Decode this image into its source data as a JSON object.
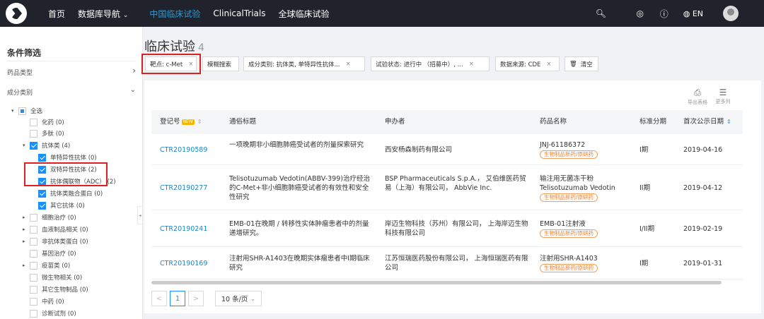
{
  "nav": {
    "home": "首页",
    "db_nav": "数据库导航",
    "items": [
      "中国临床试验",
      "ClinicalTrials",
      "全球临床试验"
    ],
    "lang": "EN"
  },
  "sidebar": {
    "title": "条件筛选",
    "sections": [
      {
        "label": "药品类型",
        "chevron": "›"
      },
      {
        "label": "成分类别",
        "chevron": "⌄"
      }
    ],
    "tree": [
      {
        "label": "全选",
        "level": 0,
        "state": "half",
        "toggle": "▾"
      },
      {
        "label": "化药 (0)",
        "level": 1,
        "state": "off",
        "toggle": ""
      },
      {
        "label": "多肽 (0)",
        "level": 1,
        "state": "off",
        "toggle": ""
      },
      {
        "label": "抗体类 (4)",
        "level": 1,
        "state": "on",
        "toggle": "▾"
      },
      {
        "label": "单特异性抗体 (0)",
        "level": 2,
        "state": "on",
        "toggle": ""
      },
      {
        "label": "双特异性抗体 (2)",
        "level": 2,
        "state": "on",
        "toggle": ""
      },
      {
        "label": "抗体偶联物（ADC） (2)",
        "level": 2,
        "state": "on",
        "toggle": ""
      },
      {
        "label": "抗体类融合蛋白 (0)",
        "level": 2,
        "state": "on",
        "toggle": ""
      },
      {
        "label": "其它抗体 (0)",
        "level": 2,
        "state": "on",
        "toggle": ""
      },
      {
        "label": "细胞治疗 (0)",
        "level": 1,
        "state": "off",
        "toggle": "▸"
      },
      {
        "label": "血液制品相关 (0)",
        "level": 1,
        "state": "off",
        "toggle": "▸"
      },
      {
        "label": "非抗体类蛋白 (0)",
        "level": 1,
        "state": "off",
        "toggle": "▸"
      },
      {
        "label": "基因治疗 (0)",
        "level": 1,
        "state": "off",
        "toggle": ""
      },
      {
        "label": "疫苗类 (0)",
        "level": 1,
        "state": "off",
        "toggle": "▸"
      },
      {
        "label": "微生物相关 (0)",
        "level": 1,
        "state": "off",
        "toggle": ""
      },
      {
        "label": "其它生物制品 (0)",
        "level": 1,
        "state": "off",
        "toggle": ""
      },
      {
        "label": "中药 (0)",
        "level": 1,
        "state": "off",
        "toggle": ""
      },
      {
        "label": "诊断试剂 (0)",
        "level": 1,
        "state": "off",
        "toggle": ""
      }
    ]
  },
  "page": {
    "title": "临床试验",
    "count": "4"
  },
  "filters": {
    "target": "靶点: c-Met",
    "fuzzy": "模糊搜索",
    "component": "成分类别: 抗体类, 单特异性抗体...",
    "status": "试验状态: 进行中 （招募中）, ...",
    "source": "数据来源: CDE",
    "clear": "清空",
    "close": "×"
  },
  "tools": {
    "export": "导出表格",
    "more": "更多列"
  },
  "table": {
    "headers": {
      "reg_no": "登记号",
      "new": "NEW",
      "title": "通俗标题",
      "sponsor": "申办者",
      "drug": "药品名称",
      "phase": "标准分期",
      "date": "首次公示日期"
    },
    "rows": [
      {
        "id": "CTR20190589",
        "title": "一项晚期非小细胞肺癌受试者的剂量探索研究",
        "sponsor": "西安杨森制药有限公司",
        "drug": "JNJ-61186372",
        "tag": "生物制品新药/原研药",
        "phase": "I期",
        "date": "2019-04-16"
      },
      {
        "id": "CTR20190277",
        "title": "Telisotuzumab Vedotin(ABBV-399)治疗经治的C-Met+非小细胞肺癌受试者的有效性和安全性研究",
        "sponsor": "BSP Pharmaceuticals S.p.A.， 艾伯维医药贸易（上海）有限公司， AbbVie Inc.",
        "drug": "输注用无菌冻干粉Telisotuzumab Vedotin",
        "tag": "生物制品新药/原研药",
        "phase": "II期",
        "date": "2019-04-12"
      },
      {
        "id": "CTR20190241",
        "title": "EMB-01在晚期 / 转移性实体肿瘤患者中的剂量递增研究。",
        "sponsor": "岸迈生物科技（苏州）有限公司， 上海岸迈生物科技有限公司",
        "drug": "EMB-01注射液",
        "tag": "生物制品新药/原研药",
        "phase": "I/II期",
        "date": "2019-02-19"
      },
      {
        "id": "CTR20190169",
        "title": "注射用SHR-A1403在晚期实体瘤患者中I期临床研究",
        "sponsor": "江苏恒瑞医药股份有限公司， 上海恒瑞医药有限公司",
        "drug": "注射用SHR-A1403",
        "tag": "生物制品新药/原研药",
        "phase": "I期",
        "date": "2019-01-31"
      }
    ]
  },
  "pagination": {
    "prev": "<",
    "current": "1",
    "next": ">",
    "page_size": "10 条/页"
  },
  "colors": {
    "nav_bg": "#20232b",
    "accent": "#1890ff",
    "link": "#1a87c9",
    "highlight_box": "#e02020",
    "tag": "#e8823a"
  }
}
